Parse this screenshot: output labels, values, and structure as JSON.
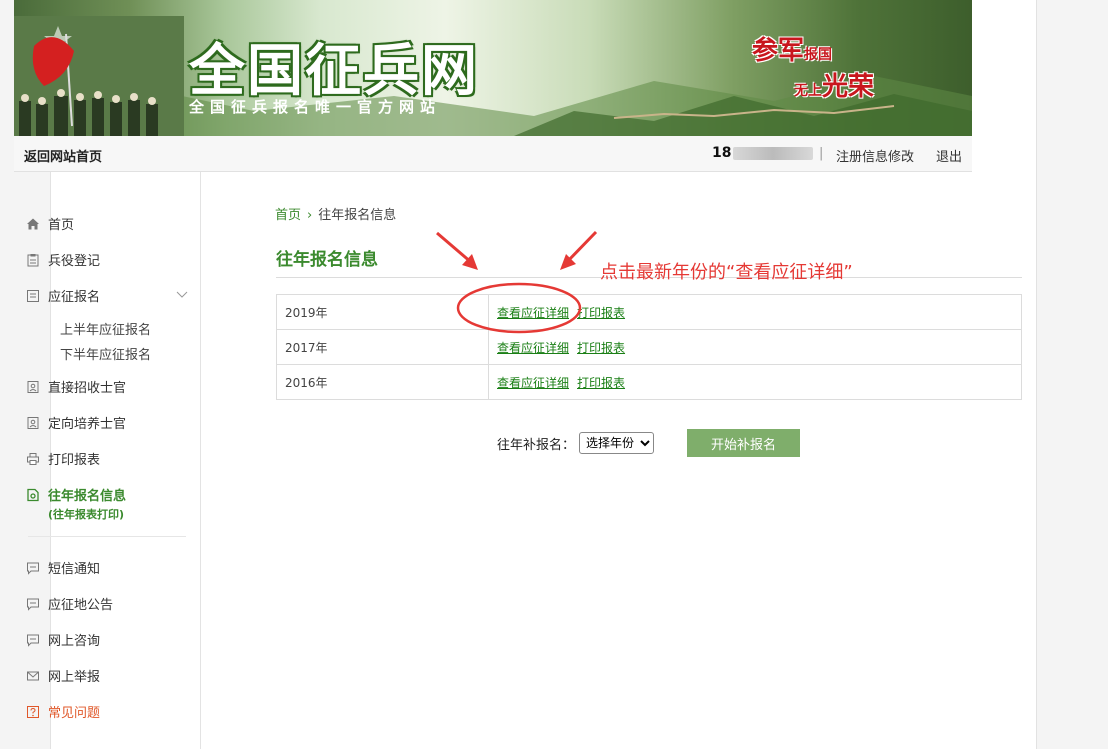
{
  "banner": {
    "title": "全国征兵网",
    "subtitle": "全国征兵报名唯一官方网站",
    "slogan_a1": "参军",
    "slogan_a2": "报国",
    "slogan_b1": "无上",
    "slogan_b2": "光荣"
  },
  "topbar": {
    "home_link": "返回网站首页",
    "user_prefix": "18",
    "separator": "|",
    "edit_link": "注册信息修改",
    "logout_link": "退出"
  },
  "sidebar": {
    "items": [
      {
        "label": "首页"
      },
      {
        "label": "兵役登记"
      },
      {
        "label": "应征报名"
      },
      {
        "label": "直接招收士官"
      },
      {
        "label": "定向培养士官"
      },
      {
        "label": "打印报表"
      },
      {
        "label": "往年报名信息"
      },
      {
        "label": "短信通知"
      },
      {
        "label": "应征地公告"
      },
      {
        "label": "网上咨询"
      },
      {
        "label": "网上举报"
      },
      {
        "label": "常见问题"
      }
    ],
    "sub_items": [
      {
        "label": "上半年应征报名"
      },
      {
        "label": "下半年应征报名"
      }
    ],
    "active_sub": "(往年报表打印)"
  },
  "breadcrumb": {
    "home": "首页",
    "arrow": "›",
    "current": "往年报名信息"
  },
  "main": {
    "title": "往年报名信息",
    "rows": [
      {
        "year": "2019年",
        "detail": "查看应征详细",
        "print": "打印报表"
      },
      {
        "year": "2017年",
        "detail": "查看应征详细",
        "print": "打印报表"
      },
      {
        "year": "2016年",
        "detail": "查看应征详细",
        "print": "打印报表"
      }
    ],
    "resign_label": "往年补报名：",
    "select_value": "选择年份",
    "start_button": "开始补报名"
  },
  "annotation": {
    "text": "点击最新年份的“查看应征详细”"
  },
  "colors": {
    "accent_green": "#3b8a2e",
    "link_green": "#1a7f15",
    "button_green": "#7fae6b",
    "annotation_red": "#e53935",
    "highlight_orange": "#e0582a"
  }
}
